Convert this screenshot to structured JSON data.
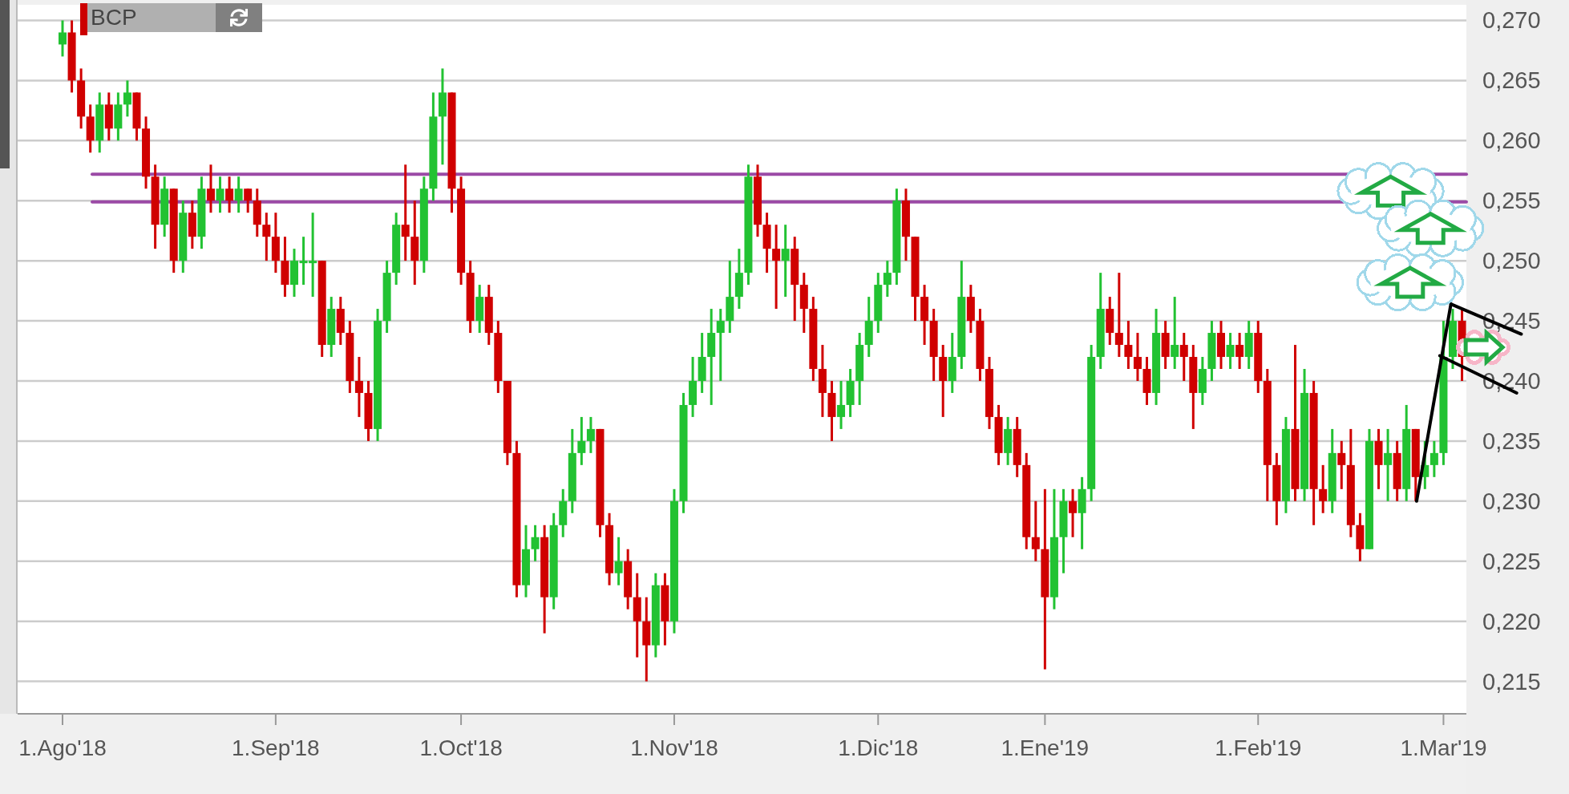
{
  "toolbar": {
    "symbol": "BCP"
  },
  "chart": {
    "chart_data": {
      "type": "candlestick",
      "grid": true,
      "ylim": [
        0.2123,
        0.2713
      ],
      "yticks": [
        {
          "value": 0.215,
          "label": "0,215"
        },
        {
          "value": 0.22,
          "label": "0,220"
        },
        {
          "value": 0.225,
          "label": "0,225"
        },
        {
          "value": 0.23,
          "label": "0,230"
        },
        {
          "value": 0.235,
          "label": "0,235"
        },
        {
          "value": 0.24,
          "label": "0,240"
        },
        {
          "value": 0.245,
          "label": "0,245"
        },
        {
          "value": 0.25,
          "label": "0,250"
        },
        {
          "value": 0.255,
          "label": "0,255"
        },
        {
          "value": 0.26,
          "label": "0,260"
        },
        {
          "value": 0.265,
          "label": "0,265"
        },
        {
          "value": 0.27,
          "label": "0,270"
        }
      ],
      "categories": [
        "1.Ago'18",
        null,
        null,
        null,
        null,
        null,
        null,
        null,
        null,
        null,
        null,
        null,
        null,
        null,
        null,
        null,
        null,
        null,
        null,
        null,
        null,
        null,
        null,
        "1.Sep'18",
        null,
        null,
        null,
        null,
        null,
        null,
        null,
        null,
        null,
        null,
        null,
        null,
        null,
        null,
        null,
        null,
        null,
        null,
        null,
        "1.Oct'18",
        null,
        null,
        null,
        null,
        null,
        null,
        null,
        null,
        null,
        null,
        null,
        null,
        null,
        null,
        null,
        null,
        null,
        null,
        null,
        null,
        null,
        null,
        "1.Nov'18",
        null,
        null,
        null,
        null,
        null,
        null,
        null,
        null,
        null,
        null,
        null,
        null,
        null,
        null,
        null,
        null,
        null,
        null,
        null,
        null,
        null,
        "1.Dic'18",
        null,
        null,
        null,
        null,
        null,
        null,
        null,
        null,
        null,
        null,
        null,
        null,
        null,
        null,
        null,
        null,
        null,
        "1.Ene'19",
        null,
        null,
        null,
        null,
        null,
        null,
        null,
        null,
        null,
        null,
        null,
        null,
        null,
        null,
        null,
        null,
        null,
        null,
        null,
        null,
        null,
        null,
        "1.Feb'19",
        null,
        null,
        null,
        null,
        null,
        null,
        null,
        null,
        null,
        null,
        null,
        null,
        null,
        null,
        null,
        null,
        null,
        null,
        null,
        "1.Mar'19",
        null,
        null
      ],
      "ohlc": [
        [
          0.268,
          0.27,
          0.267,
          0.269
        ],
        [
          0.269,
          0.27,
          0.264,
          0.265
        ],
        [
          0.265,
          0.266,
          0.261,
          0.262
        ],
        [
          0.262,
          0.263,
          0.259,
          0.26
        ],
        [
          0.26,
          0.264,
          0.259,
          0.263
        ],
        [
          0.263,
          0.264,
          0.26,
          0.261
        ],
        [
          0.261,
          0.264,
          0.26,
          0.263
        ],
        [
          0.263,
          0.265,
          0.262,
          0.264
        ],
        [
          0.264,
          0.264,
          0.26,
          0.261
        ],
        [
          0.261,
          0.262,
          0.256,
          0.257
        ],
        [
          0.257,
          0.258,
          0.251,
          0.253
        ],
        [
          0.253,
          0.257,
          0.252,
          0.256
        ],
        [
          0.256,
          0.256,
          0.249,
          0.25
        ],
        [
          0.25,
          0.255,
          0.249,
          0.254
        ],
        [
          0.254,
          0.255,
          0.251,
          0.252
        ],
        [
          0.252,
          0.257,
          0.251,
          0.256
        ],
        [
          0.256,
          0.258,
          0.254,
          0.255
        ],
        [
          0.255,
          0.257,
          0.254,
          0.256
        ],
        [
          0.256,
          0.257,
          0.254,
          0.255
        ],
        [
          0.255,
          0.257,
          0.254,
          0.256
        ],
        [
          0.256,
          0.256,
          0.254,
          0.255
        ],
        [
          0.255,
          0.256,
          0.252,
          0.253
        ],
        [
          0.253,
          0.254,
          0.25,
          0.252
        ],
        [
          0.252,
          0.254,
          0.249,
          0.25
        ],
        [
          0.25,
          0.252,
          0.247,
          0.248
        ],
        [
          0.248,
          0.251,
          0.247,
          0.25
        ],
        [
          0.25,
          0.252,
          0.248,
          0.25
        ],
        [
          0.25,
          0.254,
          0.247,
          0.25
        ],
        [
          0.25,
          0.25,
          0.242,
          0.243
        ],
        [
          0.243,
          0.247,
          0.242,
          0.246
        ],
        [
          0.246,
          0.247,
          0.243,
          0.244
        ],
        [
          0.244,
          0.245,
          0.239,
          0.24
        ],
        [
          0.24,
          0.242,
          0.237,
          0.239
        ],
        [
          0.239,
          0.24,
          0.235,
          0.236
        ],
        [
          0.236,
          0.246,
          0.235,
          0.245
        ],
        [
          0.245,
          0.25,
          0.244,
          0.249
        ],
        [
          0.249,
          0.254,
          0.248,
          0.253
        ],
        [
          0.253,
          0.258,
          0.25,
          0.252
        ],
        [
          0.252,
          0.255,
          0.248,
          0.25
        ],
        [
          0.25,
          0.257,
          0.249,
          0.256
        ],
        [
          0.256,
          0.264,
          0.255,
          0.262
        ],
        [
          0.262,
          0.266,
          0.258,
          0.264
        ],
        [
          0.264,
          0.264,
          0.254,
          0.256
        ],
        [
          0.256,
          0.257,
          0.248,
          0.249
        ],
        [
          0.249,
          0.25,
          0.244,
          0.245
        ],
        [
          0.245,
          0.248,
          0.244,
          0.247
        ],
        [
          0.247,
          0.248,
          0.243,
          0.244
        ],
        [
          0.244,
          0.245,
          0.239,
          0.24
        ],
        [
          0.24,
          0.24,
          0.233,
          0.234
        ],
        [
          0.234,
          0.235,
          0.222,
          0.223
        ],
        [
          0.223,
          0.228,
          0.222,
          0.226
        ],
        [
          0.226,
          0.228,
          0.225,
          0.227
        ],
        [
          0.227,
          0.228,
          0.219,
          0.222
        ],
        [
          0.222,
          0.229,
          0.221,
          0.228
        ],
        [
          0.228,
          0.231,
          0.227,
          0.23
        ],
        [
          0.23,
          0.236,
          0.229,
          0.234
        ],
        [
          0.234,
          0.237,
          0.233,
          0.235
        ],
        [
          0.235,
          0.237,
          0.234,
          0.236
        ],
        [
          0.236,
          0.236,
          0.227,
          0.228
        ],
        [
          0.228,
          0.229,
          0.223,
          0.224
        ],
        [
          0.224,
          0.227,
          0.223,
          0.225
        ],
        [
          0.225,
          0.226,
          0.221,
          0.222
        ],
        [
          0.222,
          0.224,
          0.217,
          0.22
        ],
        [
          0.22,
          0.222,
          0.215,
          0.218
        ],
        [
          0.218,
          0.224,
          0.217,
          0.223
        ],
        [
          0.223,
          0.224,
          0.218,
          0.22
        ],
        [
          0.22,
          0.231,
          0.219,
          0.23
        ],
        [
          0.23,
          0.239,
          0.229,
          0.238
        ],
        [
          0.238,
          0.242,
          0.237,
          0.24
        ],
        [
          0.24,
          0.244,
          0.239,
          0.242
        ],
        [
          0.242,
          0.246,
          0.238,
          0.244
        ],
        [
          0.244,
          0.246,
          0.24,
          0.245
        ],
        [
          0.245,
          0.25,
          0.244,
          0.247
        ],
        [
          0.247,
          0.251,
          0.246,
          0.249
        ],
        [
          0.249,
          0.258,
          0.248,
          0.257
        ],
        [
          0.257,
          0.258,
          0.252,
          0.253
        ],
        [
          0.253,
          0.254,
          0.249,
          0.251
        ],
        [
          0.251,
          0.253,
          0.246,
          0.25
        ],
        [
          0.25,
          0.253,
          0.247,
          0.251
        ],
        [
          0.251,
          0.252,
          0.245,
          0.248
        ],
        [
          0.248,
          0.249,
          0.244,
          0.246
        ],
        [
          0.246,
          0.247,
          0.24,
          0.241
        ],
        [
          0.241,
          0.243,
          0.237,
          0.239
        ],
        [
          0.239,
          0.24,
          0.235,
          0.237
        ],
        [
          0.237,
          0.24,
          0.236,
          0.238
        ],
        [
          0.238,
          0.241,
          0.237,
          0.24
        ],
        [
          0.24,
          0.244,
          0.238,
          0.243
        ],
        [
          0.243,
          0.247,
          0.242,
          0.245
        ],
        [
          0.245,
          0.249,
          0.244,
          0.248
        ],
        [
          0.248,
          0.25,
          0.247,
          0.249
        ],
        [
          0.249,
          0.256,
          0.248,
          0.255
        ],
        [
          0.255,
          0.256,
          0.25,
          0.252
        ],
        [
          0.252,
          0.252,
          0.245,
          0.247
        ],
        [
          0.247,
          0.248,
          0.243,
          0.245
        ],
        [
          0.245,
          0.246,
          0.24,
          0.242
        ],
        [
          0.242,
          0.243,
          0.237,
          0.24
        ],
        [
          0.24,
          0.244,
          0.239,
          0.242
        ],
        [
          0.242,
          0.25,
          0.241,
          0.247
        ],
        [
          0.247,
          0.248,
          0.244,
          0.245
        ],
        [
          0.245,
          0.246,
          0.24,
          0.241
        ],
        [
          0.241,
          0.242,
          0.236,
          0.237
        ],
        [
          0.237,
          0.238,
          0.233,
          0.234
        ],
        [
          0.234,
          0.237,
          0.233,
          0.236
        ],
        [
          0.236,
          0.237,
          0.232,
          0.233
        ],
        [
          0.233,
          0.234,
          0.226,
          0.227
        ],
        [
          0.227,
          0.23,
          0.225,
          0.226
        ],
        [
          0.226,
          0.231,
          0.216,
          0.222
        ],
        [
          0.222,
          0.231,
          0.221,
          0.227
        ],
        [
          0.227,
          0.231,
          0.224,
          0.23
        ],
        [
          0.23,
          0.231,
          0.227,
          0.229
        ],
        [
          0.229,
          0.232,
          0.226,
          0.231
        ],
        [
          0.231,
          0.243,
          0.23,
          0.242
        ],
        [
          0.242,
          0.249,
          0.241,
          0.246
        ],
        [
          0.246,
          0.247,
          0.243,
          0.244
        ],
        [
          0.244,
          0.249,
          0.242,
          0.243
        ],
        [
          0.243,
          0.245,
          0.241,
          0.242
        ],
        [
          0.242,
          0.244,
          0.24,
          0.241
        ],
        [
          0.241,
          0.242,
          0.238,
          0.239
        ],
        [
          0.239,
          0.246,
          0.238,
          0.244
        ],
        [
          0.244,
          0.245,
          0.241,
          0.242
        ],
        [
          0.242,
          0.247,
          0.241,
          0.243
        ],
        [
          0.243,
          0.244,
          0.24,
          0.242
        ],
        [
          0.242,
          0.243,
          0.236,
          0.239
        ],
        [
          0.239,
          0.242,
          0.238,
          0.241
        ],
        [
          0.241,
          0.245,
          0.24,
          0.244
        ],
        [
          0.244,
          0.245,
          0.241,
          0.242
        ],
        [
          0.242,
          0.244,
          0.241,
          0.243
        ],
        [
          0.243,
          0.244,
          0.241,
          0.242
        ],
        [
          0.242,
          0.245,
          0.241,
          0.244
        ],
        [
          0.244,
          0.245,
          0.239,
          0.24
        ],
        [
          0.24,
          0.241,
          0.23,
          0.233
        ],
        [
          0.233,
          0.234,
          0.228,
          0.23
        ],
        [
          0.23,
          0.237,
          0.229,
          0.236
        ],
        [
          0.236,
          0.243,
          0.23,
          0.231
        ],
        [
          0.231,
          0.241,
          0.23,
          0.239
        ],
        [
          0.239,
          0.24,
          0.228,
          0.231
        ],
        [
          0.231,
          0.233,
          0.229,
          0.23
        ],
        [
          0.23,
          0.236,
          0.229,
          0.234
        ],
        [
          0.234,
          0.235,
          0.231,
          0.233
        ],
        [
          0.233,
          0.236,
          0.227,
          0.228
        ],
        [
          0.228,
          0.229,
          0.225,
          0.226
        ],
        [
          0.226,
          0.236,
          0.226,
          0.235
        ],
        [
          0.235,
          0.236,
          0.231,
          0.233
        ],
        [
          0.233,
          0.236,
          0.23,
          0.234
        ],
        [
          0.234,
          0.235,
          0.23,
          0.231
        ],
        [
          0.231,
          0.238,
          0.23,
          0.236
        ],
        [
          0.236,
          0.236,
          0.23,
          0.232
        ],
        [
          0.232,
          0.235,
          0.231,
          0.233
        ],
        [
          0.233,
          0.235,
          0.232,
          0.234
        ],
        [
          0.234,
          0.245,
          0.233,
          0.242
        ],
        [
          0.242,
          0.246,
          0.241,
          0.245
        ],
        [
          0.245,
          0.246,
          0.24,
          0.242
        ]
      ],
      "ref_lines": [
        {
          "axis": "y",
          "value": 0.2572,
          "color": "#9b4aa6"
        },
        {
          "axis": "y",
          "value": 0.2549,
          "color": "#9b4aa6"
        }
      ]
    }
  },
  "drawings": [
    {
      "kind": "cloud-up",
      "color": "#a0d8ea"
    },
    {
      "kind": "cloud-up",
      "color": "#a0d8ea"
    },
    {
      "kind": "cloud-up",
      "color": "#a0d8ea"
    },
    {
      "kind": "cloud-right",
      "color": "#f7b6c8"
    }
  ]
}
